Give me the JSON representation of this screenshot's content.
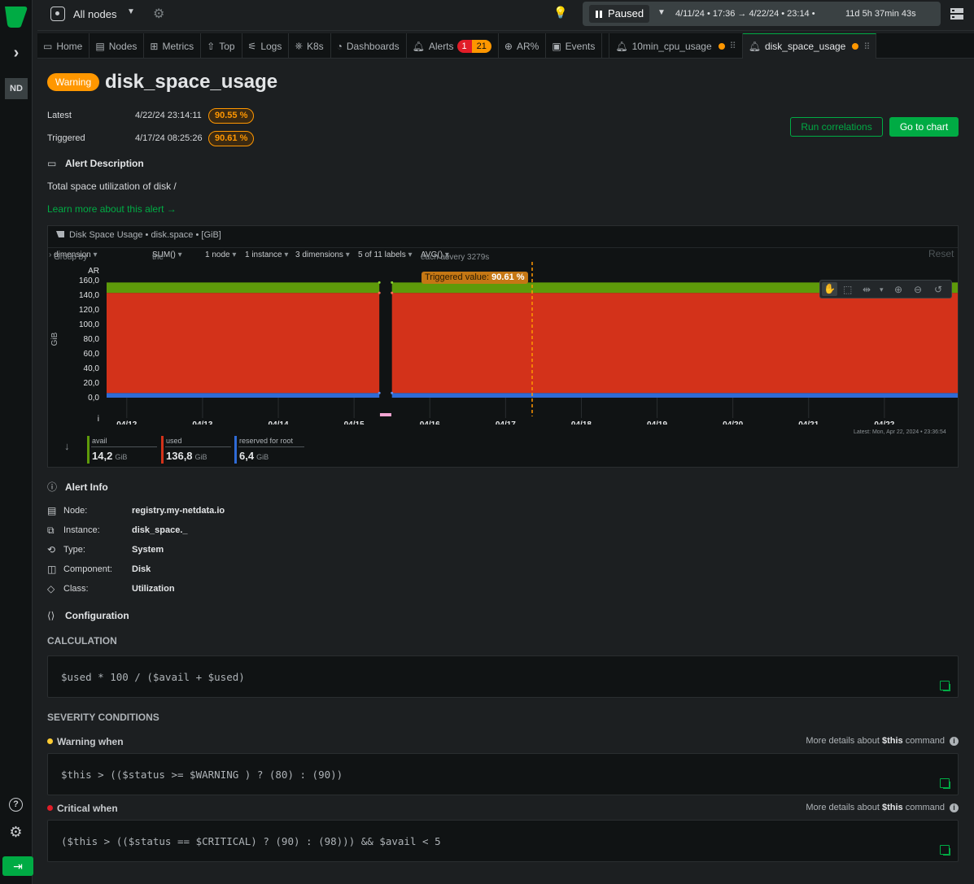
{
  "sidebar": {
    "badge": "ND"
  },
  "topbar": {
    "nodes_label": "All nodes",
    "paused_label": "Paused",
    "time_range": "4/11/24 • 17:36 → 4/22/24 • 23:14 •",
    "duration": "11d 5h 37min 43s"
  },
  "tabs": [
    {
      "label": "Home",
      "icon": "home-icon"
    },
    {
      "label": "Nodes",
      "icon": "nodes-icon"
    },
    {
      "label": "Metrics",
      "icon": "metrics-icon"
    },
    {
      "label": "Top",
      "icon": "top-icon"
    },
    {
      "label": "Logs",
      "icon": "logs-icon"
    },
    {
      "label": "K8s",
      "icon": "k8s-icon"
    },
    {
      "label": "Dashboards",
      "icon": "dashboards-icon"
    },
    {
      "label": "Alerts",
      "icon": "bell-icon",
      "critical_count": "1",
      "warning_count": "21"
    },
    {
      "label": "AR%",
      "icon": "ar-icon"
    },
    {
      "label": "Events",
      "icon": "events-icon"
    },
    {
      "label": "10min_cpu_usage",
      "icon": "bell-icon"
    },
    {
      "label": "disk_space_usage",
      "icon": "bell-icon"
    }
  ],
  "alert": {
    "status": "Warning",
    "name": "disk_space_usage",
    "latest_label": "Latest",
    "latest_time": "4/22/24 23:14:11",
    "latest_value": "90.55 %",
    "triggered_label": "Triggered",
    "triggered_time": "4/17/24 08:25:26",
    "triggered_value": "90.61 %",
    "run_correlations": "Run correlations",
    "go_to_chart": "Go to chart",
    "desc_heading": "Alert Description",
    "description": "Total space utilization of disk /",
    "learn_more": "Learn more about this alert →"
  },
  "chart": {
    "title": "Disk Space Usage • disk.space • [GiB]",
    "controls": {
      "group_by_prefix": "Group by",
      "group_by": "dimension",
      "the_prefix": "the",
      "agg": "SUM()",
      "nodes": "1 node",
      "instances": "1 instance",
      "dimensions": "3 dimensions",
      "labels": "5 of 11 labels",
      "each_as_prefix": "each as",
      "each_as": "AVG()",
      "every": "every 3279s"
    },
    "reset": "Reset",
    "trigger_label_prefix": "Triggered value:",
    "trigger_label_value": "90.61 %",
    "latest_note": "Latest:  Mon, Apr 22, 2024 • 23:36:54",
    "ar_label": "AR",
    "i_label": "i"
  },
  "chart_data": {
    "type": "area",
    "stacked": true,
    "ylabel": "GiB",
    "ylim": [
      0,
      160
    ],
    "yticks": [
      "160,0",
      "140,0",
      "120,0",
      "100,0",
      "80,0",
      "60,0",
      "40,0",
      "20,0",
      "0,0"
    ],
    "xticks": [
      "04/12",
      "04/13",
      "04/14",
      "04/15",
      "04/16",
      "04/17",
      "04/18",
      "04/19",
      "04/20",
      "04/21",
      "04/22"
    ],
    "x_start": "04/11 17:36",
    "x_end": "04/22 23:14",
    "gap": [
      "04/15 08:00",
      "04/15 12:00"
    ],
    "triggered_at": "04/17 08:25",
    "series": [
      {
        "name": "reserved for root",
        "color": "#2f6bd6",
        "values": [
          6.4,
          6.4
        ]
      },
      {
        "name": "used",
        "color": "#d3321a",
        "values": [
          136.8,
          136.8
        ]
      },
      {
        "name": "avail",
        "color": "#5e9a0a",
        "values": [
          14.2,
          14.2
        ]
      }
    ]
  },
  "legend": [
    {
      "name": "avail",
      "value": "14,2",
      "unit": "GiB",
      "color": "#5e9a0a"
    },
    {
      "name": "used",
      "value": "136,8",
      "unit": "GiB",
      "color": "#d3321a"
    },
    {
      "name": "reserved for root",
      "value": "6,4",
      "unit": "GiB",
      "color": "#2f6bd6"
    }
  ],
  "alert_info": {
    "heading": "Alert Info",
    "rows": [
      {
        "key": "Node:",
        "value": "registry.my-netdata.io",
        "icon": "node-icon"
      },
      {
        "key": "Instance:",
        "value": "disk_space._",
        "icon": "instance-icon"
      },
      {
        "key": "Type:",
        "value": "System",
        "icon": "type-icon"
      },
      {
        "key": "Component:",
        "value": "Disk",
        "icon": "component-icon"
      },
      {
        "key": "Class:",
        "value": "Utilization",
        "icon": "class-icon"
      }
    ]
  },
  "configuration": {
    "heading": "Configuration",
    "calculation_heading": "CALCULATION",
    "calculation": "$used * 100 / ($avail + $used)",
    "severity_heading": "SEVERITY CONDITIONS",
    "warning_label": "Warning when",
    "warning_color": "#ffcc33",
    "warning_expr": "$this > (($status >= $WARNING ) ? (80) : (90))",
    "critical_label": "Critical when",
    "critical_color": "#e11d28",
    "critical_expr": "($this > (($status == $CRITICAL) ? (90) : (98))) && $avail < 5",
    "more_details_prefix": "More details about",
    "more_details_cmd": "$this",
    "more_details_suffix": "command"
  }
}
